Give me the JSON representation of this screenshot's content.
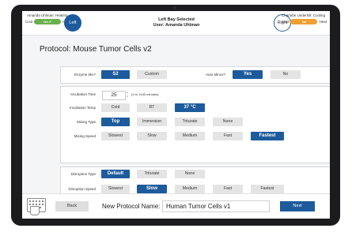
{
  "header": {
    "left_user": "Amanda Uhlman: Heating",
    "right_user": "Charlotte Underhill: Cooling",
    "left_cool": "Cool",
    "left_toggle": "On ✔",
    "left_heat": "Heat",
    "right_cool": "Cool",
    "right_toggle": "On",
    "right_heat": "Heat",
    "left_bay": "Left",
    "right_bay": "Right",
    "bay_line1": "Left Bay Selected",
    "bay_line2": "User: Amanda Uhlman",
    "accent_color": "#1d5b9c",
    "heat_toggle_color": "#6ab04c",
    "cool_toggle_color": "#f0a030"
  },
  "protocol": {
    "title": "Protocol: Mouse Tumor Cells v2"
  },
  "enzyme": {
    "label": "Enzyme Mix?",
    "options": [
      "S2",
      "Custom"
    ],
    "selected": "S2"
  },
  "auto_mince": {
    "label": "Auto Mince?",
    "options": [
      "Yes",
      "No"
    ],
    "selected": "Yes"
  },
  "incubation_time": {
    "label": "Incubation Time",
    "value": "25",
    "hint": "(0 to 1440 minutes)"
  },
  "incubation_temp": {
    "label": "Incubation Temp",
    "options": [
      "Cold",
      "RT",
      "37 °C"
    ],
    "selected": "37 °C"
  },
  "mixing_type": {
    "label": "Mixing Type",
    "options": [
      "Top",
      "Immersion",
      "Triturate",
      "None"
    ],
    "selected": "Top"
  },
  "mixing_speed": {
    "label": "Mixing Speed",
    "options": [
      "Slowest",
      "Slow",
      "Medium",
      "Fast",
      "Fastest"
    ],
    "selected": "Fastest"
  },
  "disruption_type": {
    "label": "Disruption Type",
    "options": [
      "Default",
      "Triturate",
      "None"
    ],
    "selected": "Default"
  },
  "disruption_speed": {
    "label": "Disruption Speed",
    "options": [
      "Slowest",
      "Slow",
      "Medium",
      "Fast",
      "Fastest"
    ],
    "selected": "Slow"
  },
  "footer": {
    "back_label": "Back",
    "new_name_label": "New Protocol Name:",
    "new_name_value": "Human Tumor Cells v1",
    "next_label": "Next",
    "keyboard_icon": "keyboard-icon"
  }
}
